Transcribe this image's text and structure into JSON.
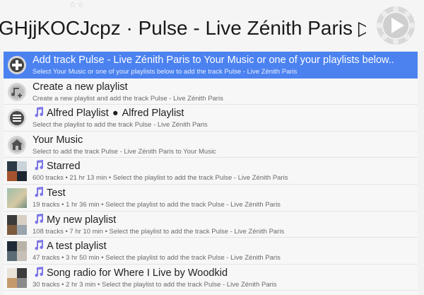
{
  "header": {
    "title": "GHjjKOCJcpz · Pulse - Live Zénith Paris",
    "title_arrow": "▷",
    "stars": "☆☆",
    "play_icon": "play-icon"
  },
  "rows": [
    {
      "icon": "plus-icon",
      "main": "Add track Pulse - Live Zénith Paris to Your Music or one of your playlists below..",
      "sub": "Select Your Music or one of your playlists below to add the track Pulse - Live Zénith Paris"
    },
    {
      "icon": "new-playlist-icon",
      "main": "Create a new playlist",
      "sub": "Create a new playlist and add the track Pulse - Live Zénith Paris"
    },
    {
      "icon": "list-icon",
      "main": "Alfred Playlist",
      "main_extra": "Alfred Playlist",
      "sub": "Select the playlist to add the track Pulse - Live Zénith Paris"
    },
    {
      "icon": "home-icon",
      "main": "Your Music",
      "sub": "Select to add the track Pulse - Live Zénith Paris to Your Music"
    },
    {
      "icon": "album-art",
      "main": "Starred",
      "sub": "600 tracks • 21 hr 13 min • Select the playlist to add the track Pulse - Live Zénith Paris"
    },
    {
      "icon": "album-art",
      "main": "Test",
      "sub": "19 tracks • 1 hr 36 min • Select the playlist to add the track Pulse - Live Zénith Paris"
    },
    {
      "icon": "album-art",
      "main": "My new playlist",
      "sub": "108 tracks • 7 hr 10 min • Select the playlist to add the track Pulse - Live Zénith Paris"
    },
    {
      "icon": "album-art",
      "main": "A test playlist",
      "sub": "47 tracks • 3 hr 50 min • Select the playlist to add the track Pulse - Live Zénith Paris"
    },
    {
      "icon": "album-art",
      "main": "Song radio for Where I Live by Woodkid",
      "sub": "30 tracks • 2 hr 3 min • Select the playlist to add the track Pulse - Live Zénith Paris"
    }
  ],
  "colors": {
    "selected_row": "#4c82f0",
    "note_icon": "#7d77e8"
  }
}
